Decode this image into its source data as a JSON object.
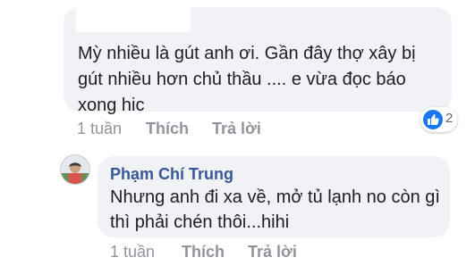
{
  "comment1": {
    "text": "Mỳ nhiều là gút anh ơi. Gần đây thợ xây bị gút nhiều hơn chủ thầu .... e vừa đọc báo xong hic",
    "time": "1 tuần",
    "like_label": "Thích",
    "reply_label": "Trả lời",
    "reaction_count": "2",
    "reaction_icon": "like-icon",
    "reaction_color": "#1877f2"
  },
  "comment2": {
    "author": "Phạm Chí Trung",
    "text": "Nhưng anh đi xa về, mở tủ lạnh no còn gì thì phải chén thôi...hihi",
    "time": "1 tuần",
    "like_label": "Thích",
    "reply_label": "Trả lời"
  },
  "colors": {
    "bubble": "#f1f2f5",
    "author": "#385898",
    "meta": "#90949c"
  }
}
